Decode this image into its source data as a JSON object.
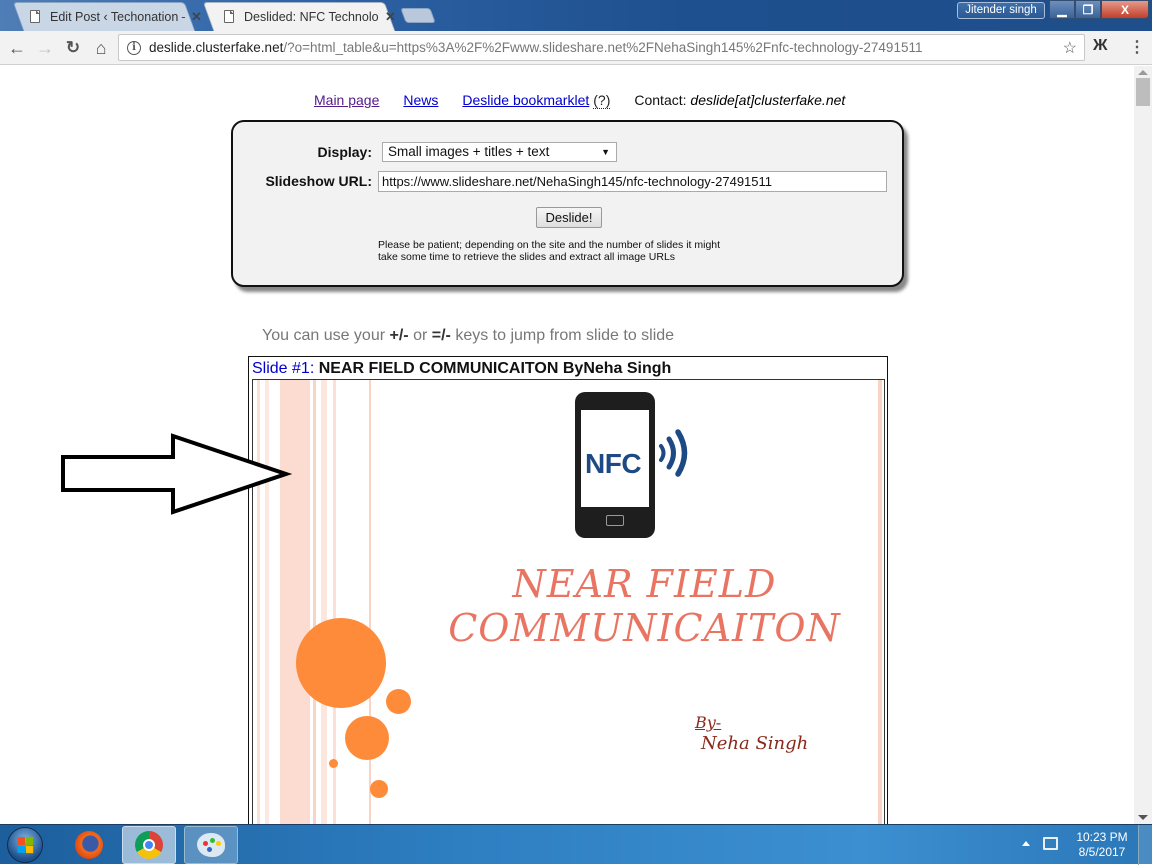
{
  "browser": {
    "tabs": [
      {
        "title": "Edit Post ‹ Techonation –",
        "active": false,
        "close_glyph": "✕"
      },
      {
        "title": "Deslided: NFC Technolog",
        "active": true,
        "close_glyph": "✕"
      }
    ],
    "profile_name": "Jitender singh",
    "window_controls": {
      "minimize": "▁",
      "maximize": "❐",
      "close": "X"
    },
    "nav": {
      "back": "←",
      "forward": "→",
      "reload": "↻",
      "home": "⌂"
    },
    "address_bar": {
      "info_glyph": "i",
      "host": "deslide.clusterfake.net",
      "rest": "/?o=html_table&u=https%3A%2F%2Fwww.slideshare.net%2FNehaSingh145%2Fnfc-technology-27491511"
    },
    "bookmark_glyph": "☆",
    "extension_glyph": "Ж",
    "menu_glyph": "⋮"
  },
  "page": {
    "nav_links": {
      "main_page": "Main page",
      "news": "News",
      "bookmarklet": "Deslide bookmarklet",
      "help": "(?)",
      "contact_label": "Contact:",
      "contact_email": "deslide[at]clusterfake.net"
    },
    "form": {
      "display_label": "Display:",
      "display_selected": "Small images + titles + text",
      "select_arrow": "▼",
      "url_label": "Slideshow URL:",
      "url_value": "https://www.slideshare.net/NehaSingh145/nfc-technology-27491511",
      "submit_label": "Deslide!",
      "note_line1": "Please be patient; depending on the site and the number of slides it might",
      "note_line2": "take some time to retrieve the slides and extract all image URLs"
    },
    "hint": {
      "prefix": "You can use your ",
      "key1": "+/-",
      "middle": " or ",
      "key2": "=/-",
      "suffix": " keys to jump from slide to slide"
    },
    "slide": {
      "number_label": "Slide #1:",
      "title": "NEAR FIELD COMMUNICAITON ByNeha Singh",
      "image": {
        "badge_text": "NFC",
        "heading_line1": "NEAR FIELD",
        "heading_line2": "COMMUNICAITON",
        "by_text": "By-",
        "author": "Neha Singh",
        "accent_color": "#e97461",
        "circle_color": "#fd8b3a",
        "stripe_color": "#fbd7cb"
      }
    }
  },
  "annotation": {
    "arrow_direction": "right"
  },
  "taskbar": {
    "apps": [
      "Start",
      "Firefox",
      "Chrome",
      "Paint"
    ],
    "clock_time": "10:23 PM",
    "clock_date": "8/5/2017"
  }
}
